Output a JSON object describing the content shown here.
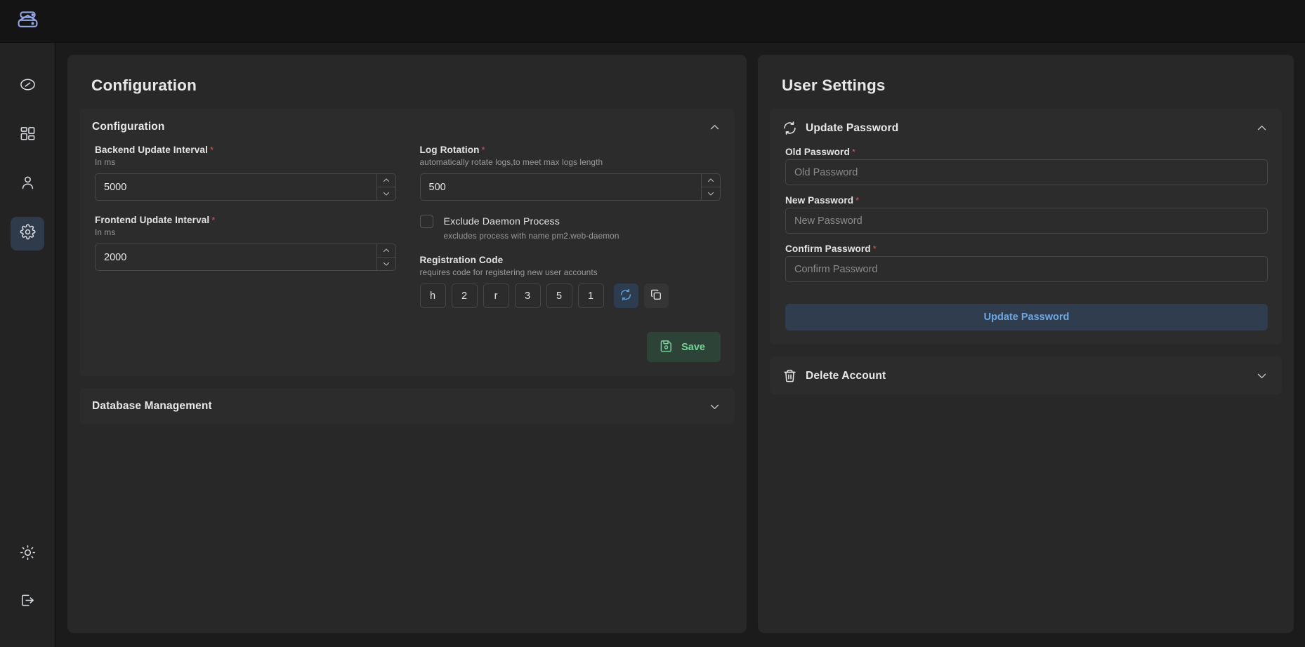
{
  "brand": {
    "icon": "database-icon"
  },
  "sidebar": {
    "items": [
      {
        "name": "dashboard",
        "icon": "gauge-icon",
        "active": false
      },
      {
        "name": "applications",
        "icon": "grid-icon",
        "active": false
      },
      {
        "name": "users",
        "icon": "user-icon",
        "active": false
      },
      {
        "name": "settings",
        "icon": "gear-icon",
        "active": true
      }
    ],
    "bottom_items": [
      {
        "name": "theme-toggle",
        "icon": "sun-icon"
      },
      {
        "name": "logout",
        "icon": "logout-icon"
      }
    ]
  },
  "configuration_panel": {
    "title": "Configuration",
    "card": {
      "title": "Configuration",
      "expanded": true,
      "fields": {
        "backend_update_interval": {
          "label": "Backend Update Interval",
          "required": "*",
          "hint": "In ms",
          "value": "5000"
        },
        "frontend_update_interval": {
          "label": "Frontend Update Interval",
          "required": "*",
          "hint": "In ms",
          "value": "2000"
        },
        "log_rotation": {
          "label": "Log Rotation",
          "required": "*",
          "hint": "automatically rotate logs,to meet max logs length",
          "value": "500"
        },
        "exclude_daemon_process": {
          "label": "Exclude Daemon Process",
          "hint": "excludes process with name pm2.web-daemon",
          "checked": false
        },
        "registration_code": {
          "label": "Registration Code",
          "hint": "requires code for registering new user accounts",
          "characters": [
            "h",
            "2",
            "r",
            "3",
            "5",
            "1"
          ],
          "refresh_icon": "refresh-icon",
          "copy_icon": "copy-icon"
        }
      },
      "save_label": "Save",
      "save_icon": "save-icon"
    },
    "database_card": {
      "title": "Database Management",
      "expanded": false
    }
  },
  "user_settings_panel": {
    "title": "User Settings",
    "update_password_card": {
      "title": "Update Password",
      "icon": "refresh-icon",
      "expanded": true,
      "old_password": {
        "label": "Old Password",
        "required": "*",
        "placeholder": "Old Password",
        "value": ""
      },
      "new_password": {
        "label": "New Password",
        "required": "*",
        "placeholder": "New Password",
        "value": ""
      },
      "confirm_password": {
        "label": "Confirm Password",
        "required": "*",
        "placeholder": "Confirm Password",
        "value": ""
      },
      "submit_label": "Update Password"
    },
    "delete_account_card": {
      "title": "Delete Account",
      "icon": "trash-icon",
      "expanded": false
    }
  },
  "colors": {
    "accent_blue": "#6fa8e0",
    "save_green": "#79d49b",
    "required_red": "#d3565a",
    "panel_bg": "#282828",
    "card_bg": "#2c2c2c",
    "rail_bg": "#232323"
  }
}
